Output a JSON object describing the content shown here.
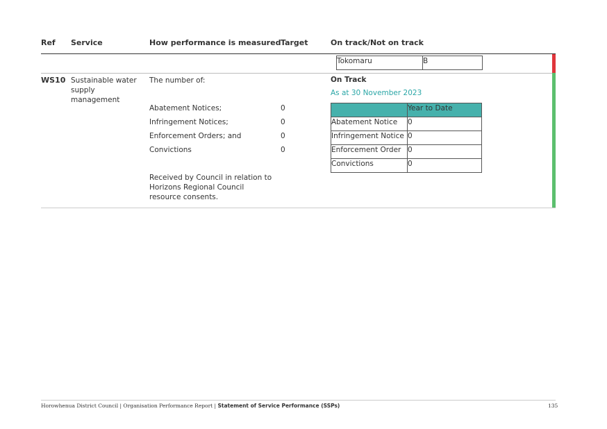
{
  "header": {
    "ref": "Ref",
    "service": "Service",
    "measure": "How performance is measured",
    "target": "Target",
    "status": "On track/Not on track"
  },
  "prev_row": {
    "table_row": {
      "name": "Tokomaru",
      "value": "B"
    },
    "status_color": "#e0353b"
  },
  "row": {
    "ref": "WS10",
    "service": "Sustainable water supply management",
    "measure_intro": "The number of:",
    "measures": [
      {
        "label": "Abatement Notices;",
        "target": "0"
      },
      {
        "label": "Infringement Notices;",
        "target": "0"
      },
      {
        "label": "Enforcement Orders; and",
        "target": "0"
      },
      {
        "label": "Convictions",
        "target": "0"
      }
    ],
    "measure_note": "Received by Council in relation to Horizons Regional Council resource consents.",
    "status": "On Track",
    "as_at": "As at 30 November 2023",
    "table_header": [
      "",
      "Year to Date"
    ],
    "table_rows": [
      {
        "name": "Abatement Notice",
        "value": "0"
      },
      {
        "name": "Infringement Notice",
        "value": "0"
      },
      {
        "name": "Enforcement Order",
        "value": "0"
      },
      {
        "name": "Convictions",
        "value": "0"
      }
    ],
    "status_color": "#5cbf6e",
    "accent_color": "#2aa6a6",
    "table_header_bg": "#46b1ac"
  },
  "footer": {
    "left": "Horowhenua District Council | Organisation Performance Report | ",
    "left_bold": "Statement of Service Performance (SSPs)",
    "page": "135"
  }
}
